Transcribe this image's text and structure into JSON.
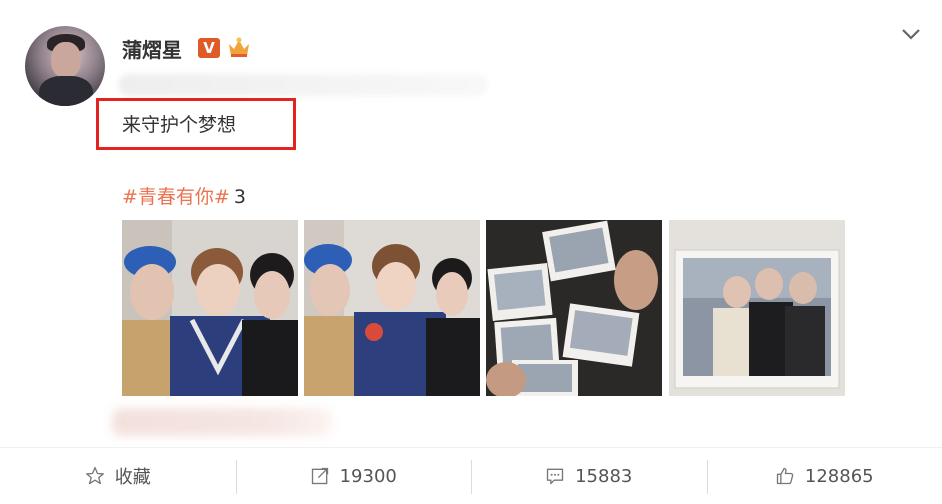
{
  "user": {
    "name": "蒲熠星",
    "verified_badge": "V"
  },
  "post": {
    "text": "来守护个梦想",
    "hashtag": "#青春有你#",
    "hashtag_count": "3"
  },
  "actions": {
    "favorite_label": "收藏",
    "repost_count": "19300",
    "comment_count": "15883",
    "like_count": "128865"
  },
  "colors": {
    "hashtag": "#eb7350",
    "highlight_box": "#e3231f",
    "verified_badge": "#e05a28"
  },
  "icons": [
    "chevron-down-icon",
    "star-icon",
    "share-icon",
    "comment-icon",
    "thumbs-up-icon",
    "crown-icon"
  ]
}
